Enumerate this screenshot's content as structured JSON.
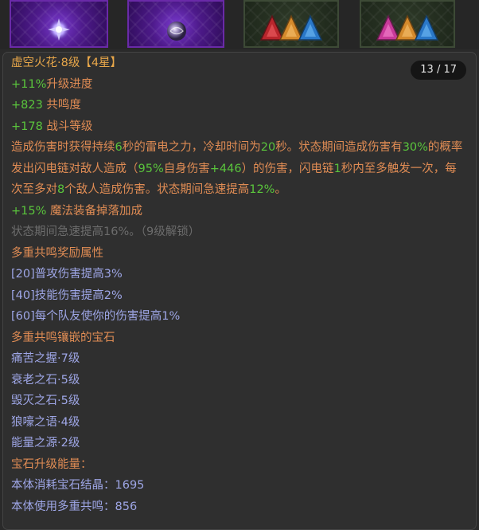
{
  "gem_slots": [
    {
      "name": "gem-socket-1",
      "frame": "purple",
      "icon": "spark-crystal-icon"
    },
    {
      "name": "gem-socket-2",
      "frame": "purple",
      "icon": "void-orb-icon"
    },
    {
      "name": "gem-socket-3",
      "frame": "green",
      "icon": "tri-gem-red-orange-blue-icon"
    },
    {
      "name": "gem-socket-4",
      "frame": "green",
      "icon": "tri-gem-pink-orange-blue-icon"
    }
  ],
  "colors": {
    "title": "#e8a74a",
    "positive": "#5ac53c",
    "description": "#e08c54",
    "locked": "#6c6c6c",
    "resonance": "#9ea6e6",
    "pager_bg": "#151515"
  },
  "tooltip": {
    "title": "虚空火花·8级【4星】",
    "pager": "13 / 17",
    "stats": [
      {
        "value": "+11%",
        "label": "升级进度"
      },
      {
        "value": "+823",
        "label": " 共鸣度"
      },
      {
        "value": "+178",
        "label": " 战斗等级"
      }
    ],
    "description": [
      {
        "t": "造成伤害时获得持续",
        "hl": false
      },
      {
        "t": "6",
        "hl": true
      },
      {
        "t": "秒的雷电之力，冷却时间为",
        "hl": false
      },
      {
        "t": "20",
        "hl": true
      },
      {
        "t": "秒。状态期间造成伤害有",
        "hl": false
      },
      {
        "t": "30%",
        "hl": true
      },
      {
        "t": "的概率发出闪电链对敌人造成（",
        "hl": false
      },
      {
        "t": "95%",
        "hl": true
      },
      {
        "t": "自身伤害",
        "hl": false
      },
      {
        "t": "+446",
        "hl": true
      },
      {
        "t": "）的伤害，闪电链",
        "hl": false
      },
      {
        "t": "1",
        "hl": true
      },
      {
        "t": "秒内至多触发一次，每次至多对",
        "hl": false
      },
      {
        "t": "8",
        "hl": true
      },
      {
        "t": "个敌人造成伤害。状态期间急速提高",
        "hl": false
      },
      {
        "t": "12%",
        "hl": true
      },
      {
        "t": "。",
        "hl": false
      }
    ],
    "magic_bonus": {
      "value": "+15%",
      "label": " 魔法装备掉落加成"
    },
    "locked_line": "状态期间急速提高16%。（9级解锁）",
    "resonance_header": "多重共鸣奖励属性",
    "resonance_bonuses": [
      "[20]普攻伤害提高3%",
      "[40]技能伤害提高2%",
      "[60]每个队友使你的伤害提高1%"
    ],
    "inlaid_header": "多重共鸣镶嵌的宝石",
    "inlaid_gems": [
      "痛苦之握·7级",
      "衰老之石·5级",
      "毁灭之石·5级",
      "狼嚎之语·4级",
      "能量之源·2级"
    ],
    "upgrade_header": "宝石升级能量：",
    "upgrade_rows": [
      {
        "label": "本体消耗宝石结晶：",
        "value": "1695"
      },
      {
        "label": "本体使用多重共鸣：",
        "value": "856"
      }
    ]
  }
}
